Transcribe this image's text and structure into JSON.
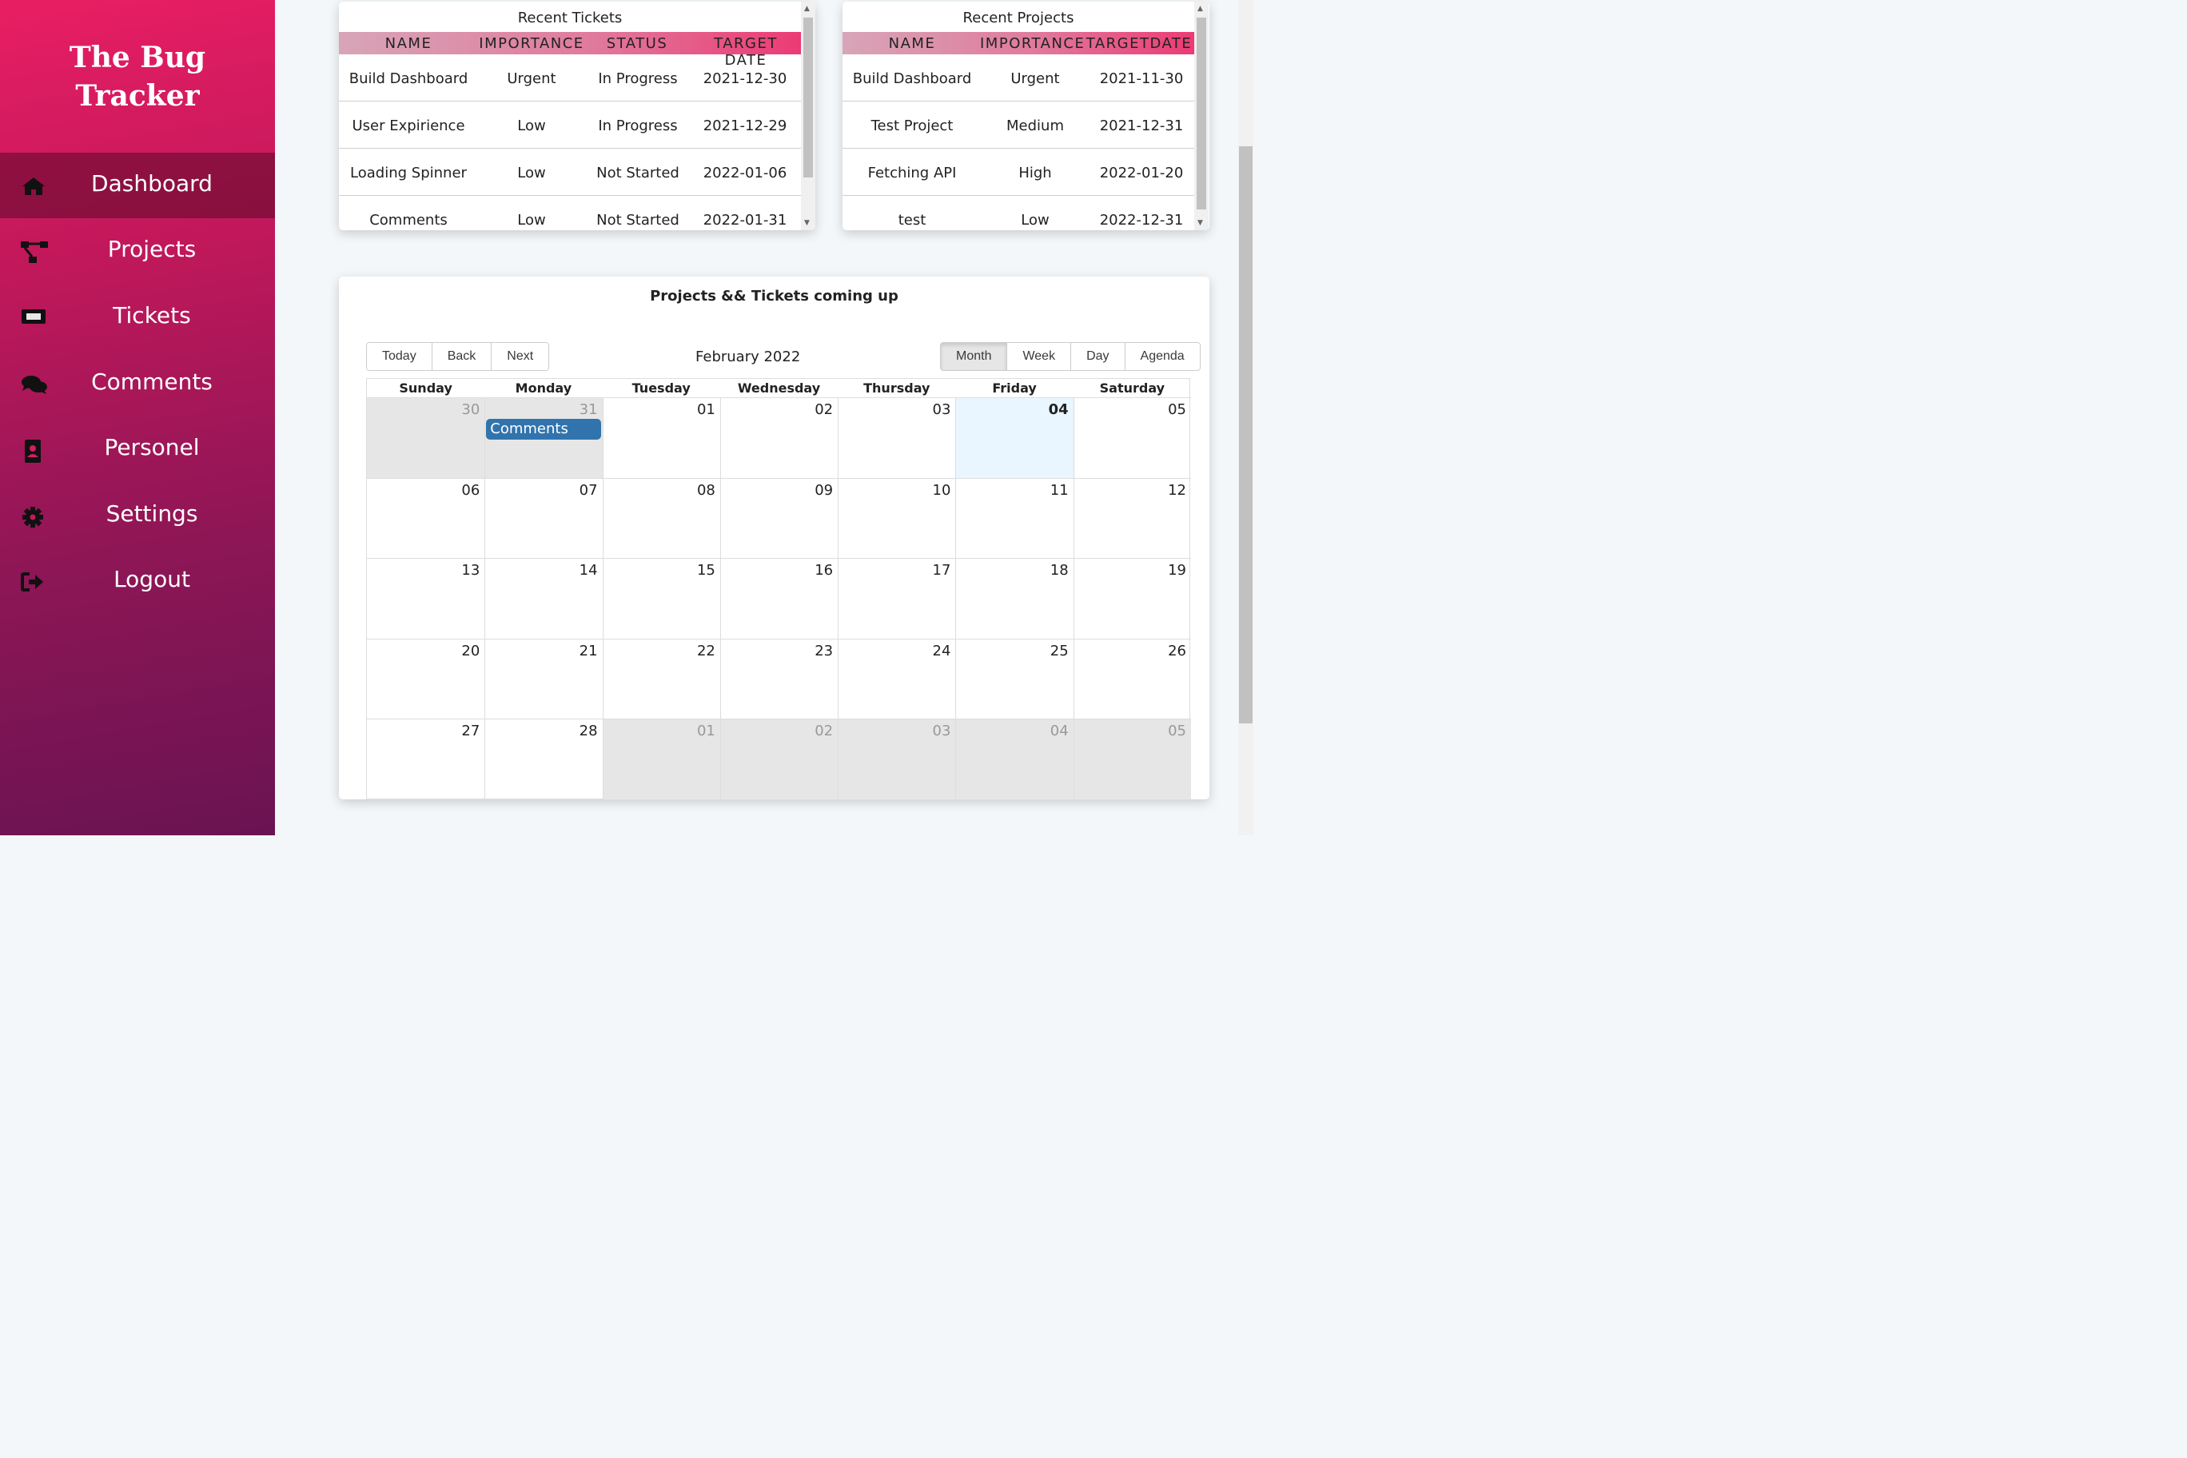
{
  "app": {
    "title_line1": "The Bug",
    "title_line2": "Tracker"
  },
  "sidebar": {
    "items": [
      {
        "label": "Dashboard",
        "icon": "home-icon",
        "active": true
      },
      {
        "label": "Projects",
        "icon": "project-diagram-icon",
        "active": false
      },
      {
        "label": "Tickets",
        "icon": "ticket-icon",
        "active": false
      },
      {
        "label": "Comments",
        "icon": "comments-icon",
        "active": false
      },
      {
        "label": "Personel",
        "icon": "address-book-icon",
        "active": false
      },
      {
        "label": "Settings",
        "icon": "gear-icon",
        "active": false
      },
      {
        "label": "Logout",
        "icon": "logout-icon",
        "active": false
      }
    ]
  },
  "recent_tickets": {
    "title": "Recent Tickets",
    "headers": [
      "NAME",
      "IMPORTANCE",
      "STATUS",
      "TARGET DATE"
    ],
    "rows": [
      [
        "Build Dashboard",
        "Urgent",
        "In Progress",
        "2021-12-30"
      ],
      [
        "User Expirience",
        "Low",
        "In Progress",
        "2021-12-29"
      ],
      [
        "Loading Spinner",
        "Low",
        "Not Started",
        "2022-01-06"
      ],
      [
        "Comments",
        "Low",
        "Not Started",
        "2022-01-31"
      ]
    ]
  },
  "recent_projects": {
    "title": "Recent Projects",
    "headers": [
      "NAME",
      "IMPORTANCE",
      "TARGETDATE"
    ],
    "rows": [
      [
        "Build Dashboard",
        "Urgent",
        "2021-11-30"
      ],
      [
        "Test Project",
        "Medium",
        "2021-12-31"
      ],
      [
        "Fetching API",
        "High",
        "2022-01-20"
      ],
      [
        "test",
        "Low",
        "2022-12-31"
      ]
    ]
  },
  "calendar": {
    "title": "Projects && Tickets coming up",
    "nav_buttons": [
      "Today",
      "Back",
      "Next"
    ],
    "label": "February 2022",
    "views": [
      "Month",
      "Week",
      "Day",
      "Agenda"
    ],
    "active_view": "Month",
    "day_headers": [
      "Sunday",
      "Monday",
      "Tuesday",
      "Wednesday",
      "Thursday",
      "Friday",
      "Saturday"
    ],
    "weeks": [
      [
        "30",
        "31",
        "01",
        "02",
        "03",
        "04",
        "05"
      ],
      [
        "06",
        "07",
        "08",
        "09",
        "10",
        "11",
        "12"
      ],
      [
        "13",
        "14",
        "15",
        "16",
        "17",
        "18",
        "19"
      ],
      [
        "20",
        "21",
        "22",
        "23",
        "24",
        "25",
        "26"
      ],
      [
        "27",
        "28",
        "01",
        "02",
        "03",
        "04",
        "05"
      ]
    ],
    "today": "04",
    "events": [
      {
        "title": "Comments",
        "week": 0,
        "day": 1
      }
    ]
  },
  "colors": {
    "accent": "#e91e63",
    "sidebar_dark": "#6a1352",
    "event": "#3174ad",
    "today_bg": "#eaf6ff"
  }
}
